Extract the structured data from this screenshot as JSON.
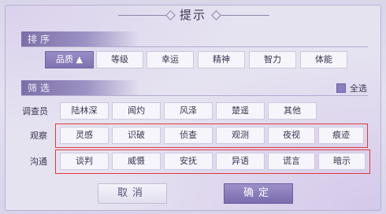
{
  "dialog": {
    "title": "提示"
  },
  "sort": {
    "header": "排序",
    "options": [
      "品质 ▲",
      "等级",
      "幸运",
      "精神",
      "智力",
      "体能"
    ],
    "selected_index": 0
  },
  "filter": {
    "header": "筛选",
    "select_all_label": "全选",
    "select_all_checked": true,
    "rows": [
      {
        "label": "调查员",
        "options": [
          "陆林深",
          "闻灼",
          "风泽",
          "楚遥",
          "其他"
        ]
      },
      {
        "label": "观察",
        "options": [
          "灵感",
          "识破",
          "侦查",
          "观测",
          "夜视",
          "痕迹"
        ]
      },
      {
        "label": "沟通",
        "options": [
          "谈判",
          "威慑",
          "安抚",
          "异语",
          "谎言",
          "暗示"
        ]
      }
    ]
  },
  "actions": {
    "cancel": "取消",
    "confirm": "确定"
  },
  "colors": {
    "accent": "#7f72b0",
    "highlight_box": "#e03a3a"
  }
}
